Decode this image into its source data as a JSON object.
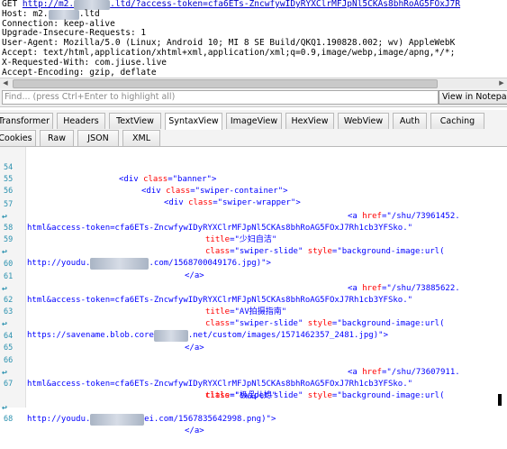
{
  "request": {
    "method": "GET",
    "url_pre": "http://m2.",
    "url_post": ".ltd/?access-token=cfa6ETs-ZncwfywIDyRYXClrMFJpNl5CKAs8bhRoAG5FOxJ7R",
    "host_label": "Host:",
    "host_pre": "m2.",
    "host_post": ".ltd",
    "headers": [
      "Connection: keep-alive",
      "Upgrade-Insecure-Requests: 1",
      "User-Agent: Mozilla/5.0 (Linux; Android 10; MI 8 SE Build/QKQ1.190828.002; wv) AppleWebK",
      "Accept: text/html,application/xhtml+xml,application/xml;q=0.9,image/webp,image/apng,*/*;",
      "X-Requested-With: com.jiuse.live",
      "Accept-Encoding: gzip, deflate"
    ]
  },
  "findbar": {
    "placeholder": "Find... (press Ctrl+Enter to highlight all)",
    "view_button": "View in Notepad"
  },
  "tabs_row1": [
    "Transformer",
    "Headers",
    "TextView",
    "SyntaxView",
    "ImageView",
    "HexView",
    "WebView",
    "Auth",
    "Caching"
  ],
  "tabs_row2": [
    "Cookies",
    "Raw",
    "JSON",
    "XML"
  ],
  "active_tab": "SyntaxView",
  "code": {
    "line54": {
      "num": "54",
      "open": "<div ",
      "attr": "class",
      "eq": "=",
      "val": "\"banner\"",
      "close": ">"
    },
    "line55": {
      "num": "55",
      "open": "<div ",
      "attr": "class",
      "eq": "=",
      "val": "\"swiper-container\"",
      "close": ">"
    },
    "line56": {
      "num": "56",
      "open": "<div ",
      "attr": "class",
      "eq": "=",
      "val": "\"swiper-wrapper\"",
      "close": ">"
    },
    "line57": {
      "num": "57",
      "open": "<a ",
      "attr": "href",
      "eq": "=",
      "val": "\"/shu/73961452."
    },
    "wrap57": "html&access-token=cfa6ETs-ZncwfywIDyRYXClrMFJpNl5CKAs8bhRoAG5FOxJ7Rh1cb3YFSko.\"",
    "line58": {
      "num": "58",
      "attr": "title",
      "eq": "=",
      "val": "\"少妇自洁\""
    },
    "line59": {
      "num": "59",
      "attr": "class",
      "eq": "=",
      "val": "\"swiper-slide\"",
      "attr2": "style",
      "val2": "\"background-image:url("
    },
    "wrap59_pre": "http://youdu.",
    "wrap59_post": ".com/1568700049176.jpg)\">",
    "line60": {
      "num": "60",
      "text": "</a>"
    },
    "line61": {
      "num": "61",
      "open": "<a ",
      "attr": "href",
      "eq": "=",
      "val": "\"/shu/73885622."
    },
    "wrap61": "html&access-token=cfa6ETs-ZncwfywIDyRYXClrMFJpNl5CKAs8bhRoAG5FOxJ7Rh1cb3YFSko.\"",
    "line62": {
      "num": "62",
      "attr": "title",
      "eq": "=",
      "val": "\"AV拍摄指南\""
    },
    "line63": {
      "num": "63",
      "attr": "class",
      "eq": "=",
      "val": "\"swiper-slide\"",
      "attr2": "style",
      "val2": "\"background-image:url("
    },
    "wrap63_pre": "https://savename.blob.core",
    "wrap63_post": ".net/custom/images/1571462357_2481.jpg)\">",
    "line64": {
      "num": "64",
      "text": "</a>"
    },
    "line65": {
      "num": "65",
      "text": ""
    },
    "line66": {
      "num": "66",
      "open": "<a ",
      "attr": "href",
      "eq": "=",
      "val": "\"/shu/73607911."
    },
    "wrap66": "html&access-token=cfa6ETs-ZncwfywIDyRYXClrMFJpNl5CKAs8bhRoAG5FOxJ7Rh1cb3YFSko.\"",
    "line67": {
      "num": "67",
      "attr": "title",
      "eq": "=",
      "val": "\"极品儿媳\""
    },
    "line67b": {
      "attr": "class",
      "eq": "=",
      "val": "\"swiper-slide\"",
      "attr2": "style",
      "val2": "\"background-image:url("
    },
    "wrap67_pre": "http://youdu.",
    "wrap67_post": "ei.com/1567835642998.png)\">",
    "line68": {
      "num": "68",
      "text": "</a>"
    }
  }
}
